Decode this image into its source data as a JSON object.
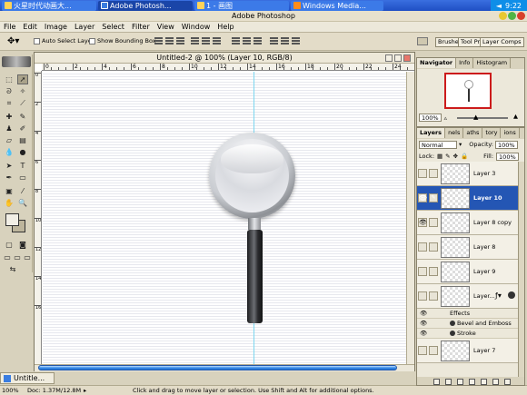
{
  "taskbar": {
    "items": [
      "火星时代动画大...",
      "Adobe Photosh...",
      "1 - 画图",
      "Windows Media..."
    ],
    "time": "9:22"
  },
  "app": {
    "title": "Adobe Photoshop"
  },
  "menu": [
    "File",
    "Edit",
    "Image",
    "Layer",
    "Select",
    "Filter",
    "View",
    "Window",
    "Help"
  ],
  "options": {
    "auto_select": "Auto Select Layer",
    "bounding_box": "Show Bounding Box",
    "palette_tabs": [
      "Brushes",
      "Tool Pr",
      "Layer Comps"
    ]
  },
  "document": {
    "title": "Untitled-2 @ 100% (Layer 10, RGB/8)",
    "ruler_marks": [
      "0",
      "2",
      "4",
      "6",
      "8",
      "10",
      "12",
      "14",
      "16",
      "18",
      "20",
      "22",
      "24"
    ],
    "ruler_v_marks": [
      "0",
      "2",
      "4",
      "6",
      "8",
      "10",
      "12",
      "14",
      "16"
    ]
  },
  "minimized_doc": "Untitle...",
  "status": {
    "zoom": "100%",
    "doc_size": "Doc: 1.37M/12.8M",
    "hint": "Click and drag to move layer or selection.  Use Shift and Alt for additional options."
  },
  "navigator": {
    "tabs": [
      "Navigator",
      "Info",
      "Histogram"
    ],
    "zoom": "100%"
  },
  "layers": {
    "tabs": [
      "Layers",
      "nels",
      "aths",
      "tory",
      "ions"
    ],
    "blend_mode": "Normal",
    "opacity_label": "Opacity:",
    "opacity": "100%",
    "lock_label": "Lock:",
    "fill_label": "Fill:",
    "fill": "100%",
    "rows": [
      {
        "name": "Layer 3",
        "visible": false,
        "selected": false
      },
      {
        "name": "Layer 10",
        "visible": true,
        "selected": true
      },
      {
        "name": "Layer 8 copy",
        "visible": true,
        "selected": false
      },
      {
        "name": "Layer 8",
        "visible": false,
        "selected": false
      },
      {
        "name": "Layer 9",
        "visible": false,
        "selected": false
      },
      {
        "name": "Layer...",
        "visible": false,
        "selected": false
      }
    ],
    "effects": [
      "Effects",
      "Bevel and Emboss",
      "Stroke"
    ],
    "last_row": "Layer 7"
  }
}
